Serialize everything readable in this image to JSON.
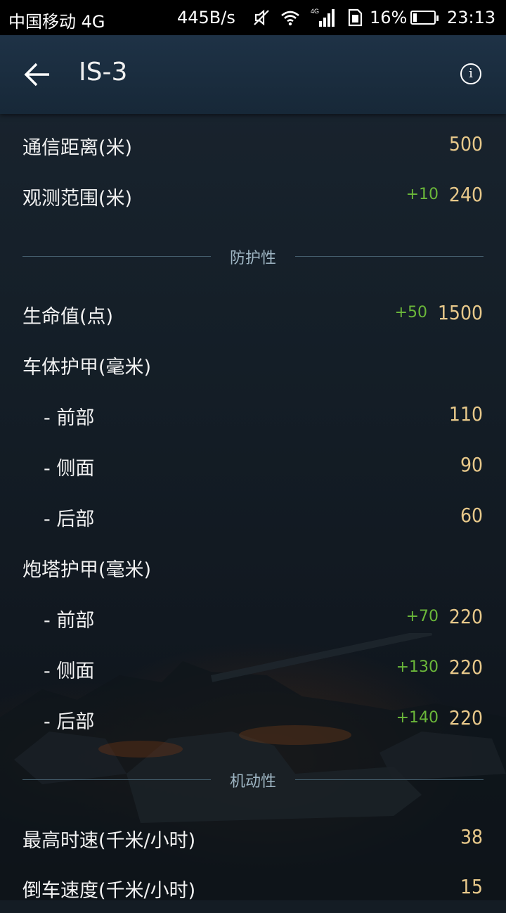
{
  "status_bar": {
    "carrier": "中国移动 4G",
    "net_speed": "445B/s",
    "battery": "16%",
    "time": "23:13",
    "icons": [
      "mute-icon",
      "wifi-icon",
      "signal-icon",
      "sim-icon"
    ]
  },
  "header": {
    "title": "IS-3",
    "back_icon": "arrow-left-icon",
    "info_icon": "info-icon",
    "info_glyph": "i"
  },
  "rows": [
    {
      "label": "通信距离(米)",
      "bonus": "",
      "value": "500"
    },
    {
      "label": "观测范围(米)",
      "bonus": "+10",
      "value": "240"
    }
  ],
  "section_protection": {
    "title": "防护性"
  },
  "protection_rows": [
    {
      "label": "生命值(点)",
      "bonus": "+50",
      "value": "1500"
    },
    {
      "label": "车体护甲(毫米)",
      "bonus": "",
      "value": ""
    },
    {
      "label": "- 前部",
      "bonus": "",
      "value": "110"
    },
    {
      "label": "- 侧面",
      "bonus": "",
      "value": "90"
    },
    {
      "label": "- 后部",
      "bonus": "",
      "value": "60"
    },
    {
      "label": "炮塔护甲(毫米)",
      "bonus": "",
      "value": ""
    },
    {
      "label": "- 前部",
      "bonus": "+70",
      "value": "220"
    },
    {
      "label": "- 侧面",
      "bonus": "+130",
      "value": "220"
    },
    {
      "label": "- 后部",
      "bonus": "+140",
      "value": "220"
    }
  ],
  "section_mobility": {
    "title": "机动性"
  },
  "mobility_rows": [
    {
      "label": "最高时速(千米/小时)",
      "bonus": "",
      "value": "38"
    },
    {
      "label": "倒车速度(千米/小时)",
      "bonus": "",
      "value": "15"
    }
  ],
  "colors": {
    "value": "#e7c88a",
    "bonus": "#6bb83a",
    "header_bg": "#1e3246",
    "section_title": "#9fb6c4"
  }
}
